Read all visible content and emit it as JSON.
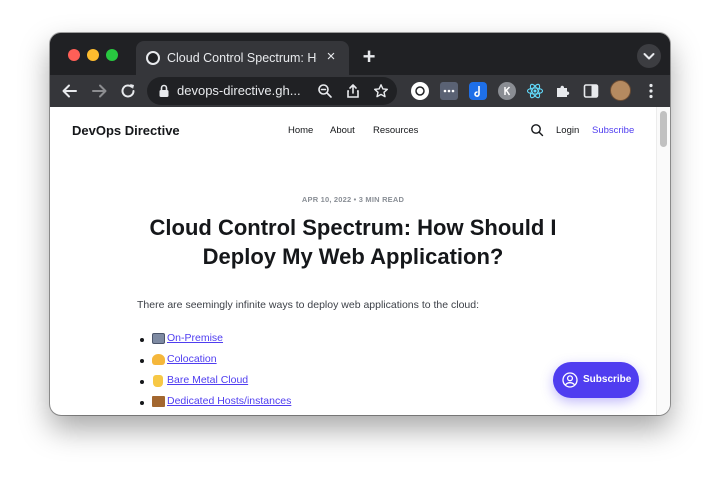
{
  "browser": {
    "tab": {
      "title": "Cloud Control Spectrum: How",
      "close_glyph": "×"
    },
    "new_tab_glyph": "+",
    "address": {
      "url": "devops-directive.gh..."
    }
  },
  "site": {
    "logo": "DevOps Directive",
    "nav": [
      "Home",
      "About",
      "Resources"
    ],
    "login": "Login",
    "subscribe": "Subscribe",
    "accent_color": "#4f3df0"
  },
  "article": {
    "meta": "APR 10, 2022 • 3 MIN READ",
    "title": "Cloud Control Spectrum: How Should I Deploy My Web Application?",
    "intro": "There are seemingly infinite ways to deploy web applications to the cloud:",
    "list": [
      {
        "label": " On-Premise",
        "icon": "office-building-emoji"
      },
      {
        "label": " Colocation",
        "icon": "handshake-emoji"
      },
      {
        "label": " Bare Metal Cloud",
        "icon": "metal-horns-emoji"
      },
      {
        "label": " Dedicated Hosts/instances",
        "icon": "wood-block-emoji"
      }
    ]
  },
  "portal_button": {
    "label": "Subscribe"
  }
}
